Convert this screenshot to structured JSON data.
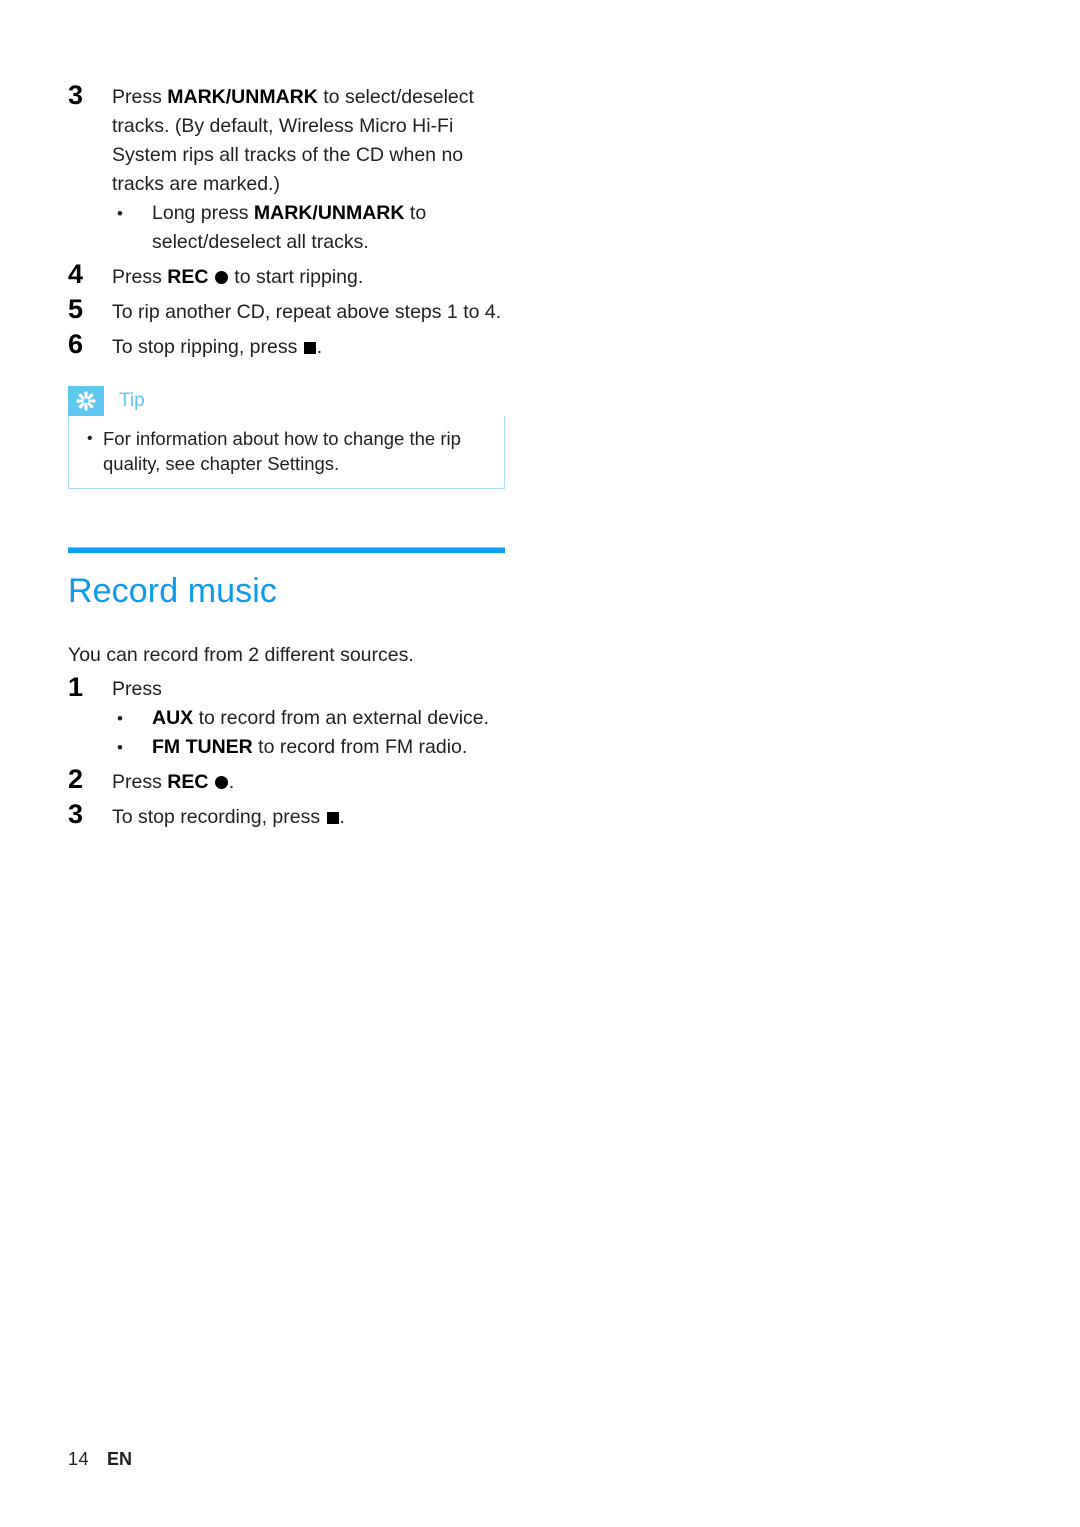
{
  "document": {
    "steps_ripping": [
      {
        "number": "3",
        "text_parts": [
          {
            "t": "Press ",
            "bold": false
          },
          {
            "t": "MARK/UNMARK",
            "bold": true
          },
          {
            "t": " to select/deselect tracks. (By default, Wireless Micro Hi-Fi System rips all tracks of the CD when no tracks are marked.)",
            "bold": false
          }
        ],
        "plain": "Press MARK/UNMARK to select/deselect tracks. (By default, Wireless Micro Hi-Fi System rips all tracks of the CD when no tracks are marked.)",
        "sub_items": [
          {
            "bullet": "•",
            "plain": "Long press MARK/UNMARK to select/deselect all tracks.",
            "text_parts": [
              {
                "t": "Long press ",
                "bold": false
              },
              {
                "t": "MARK/UNMARK",
                "bold": true
              },
              {
                "t": " to select/deselect all tracks.",
                "bold": false
              }
            ]
          }
        ]
      },
      {
        "number": "4",
        "plain": "Press REC ● to start ripping.",
        "prefix": "Press ",
        "bold_label": "REC",
        "icon": "record-dot-icon",
        "suffix": " to start ripping.",
        "sub_items": []
      },
      {
        "number": "5",
        "plain": "To rip another CD, repeat above steps 1 to 4.",
        "sub_items": []
      },
      {
        "number": "6",
        "plain": "To stop ripping, press ■.",
        "prefix": "To stop ripping, press ",
        "icon": "stop-square-icon",
        "suffix": ".",
        "sub_items": []
      }
    ],
    "tip": {
      "icon_name": "tip-asterisk-icon",
      "label": "Tip",
      "items": [
        {
          "bullet": "•",
          "text": "For information about how to change the rip quality, see chapter Settings."
        }
      ],
      "accent_color": "#5ec7f0",
      "border_color": "#a8ddf5"
    },
    "section": {
      "title": "Record music",
      "title_color": "#0d9aec",
      "rule_color": "#0a9ef5",
      "intro": "You can record from 2 different sources.",
      "steps": [
        {
          "number": "1",
          "plain": "Press",
          "sub_items": [
            {
              "bullet": "•",
              "plain": "AUX to record from an external device.",
              "bold_label": "AUX",
              "rest": " to record from an external device."
            },
            {
              "bullet": "•",
              "plain": "FM TUNER to record from FM radio.",
              "bold_label": "FM TUNER",
              "rest": " to record from FM radio."
            }
          ]
        },
        {
          "number": "2",
          "plain": "Press REC ●.",
          "prefix": "Press ",
          "bold_label": "REC",
          "icon": "record-dot-icon",
          "suffix": ".",
          "sub_items": []
        },
        {
          "number": "3",
          "plain": "To stop recording, press ■.",
          "prefix": "To stop recording, press ",
          "icon": "stop-square-icon",
          "suffix": ".",
          "sub_items": []
        }
      ]
    },
    "footer": {
      "page_number": "14",
      "language": "EN"
    }
  }
}
